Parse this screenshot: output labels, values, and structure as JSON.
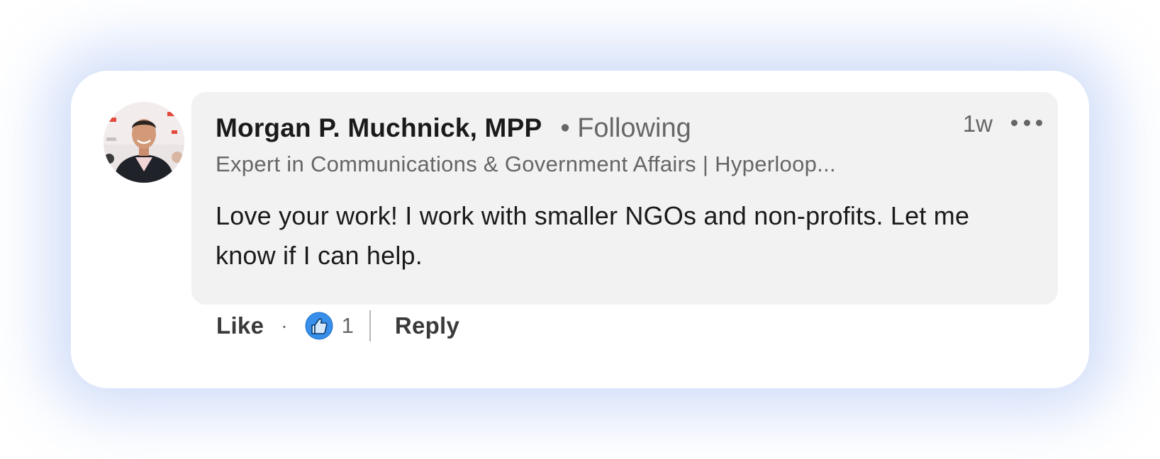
{
  "comment": {
    "author": {
      "name": "Morgan P. Muchnick, MPP",
      "following_label": "• Following",
      "headline": "Expert in Communications & Government Affairs | Hyperloop...",
      "avatar_icon": "profile-photo"
    },
    "timestamp": "1w",
    "more_icon": "ellipsis-icon",
    "text": "Love your work! I work with smaller NGOs and non-profits. Let me know if I can help.",
    "background_color": "#f2f2f2"
  },
  "actions": {
    "like_label": "Like",
    "separator": "·",
    "reaction_icon": "like-reaction-icon",
    "reaction_color": "#378fe9",
    "reaction_count": "1",
    "reply_label": "Reply"
  }
}
